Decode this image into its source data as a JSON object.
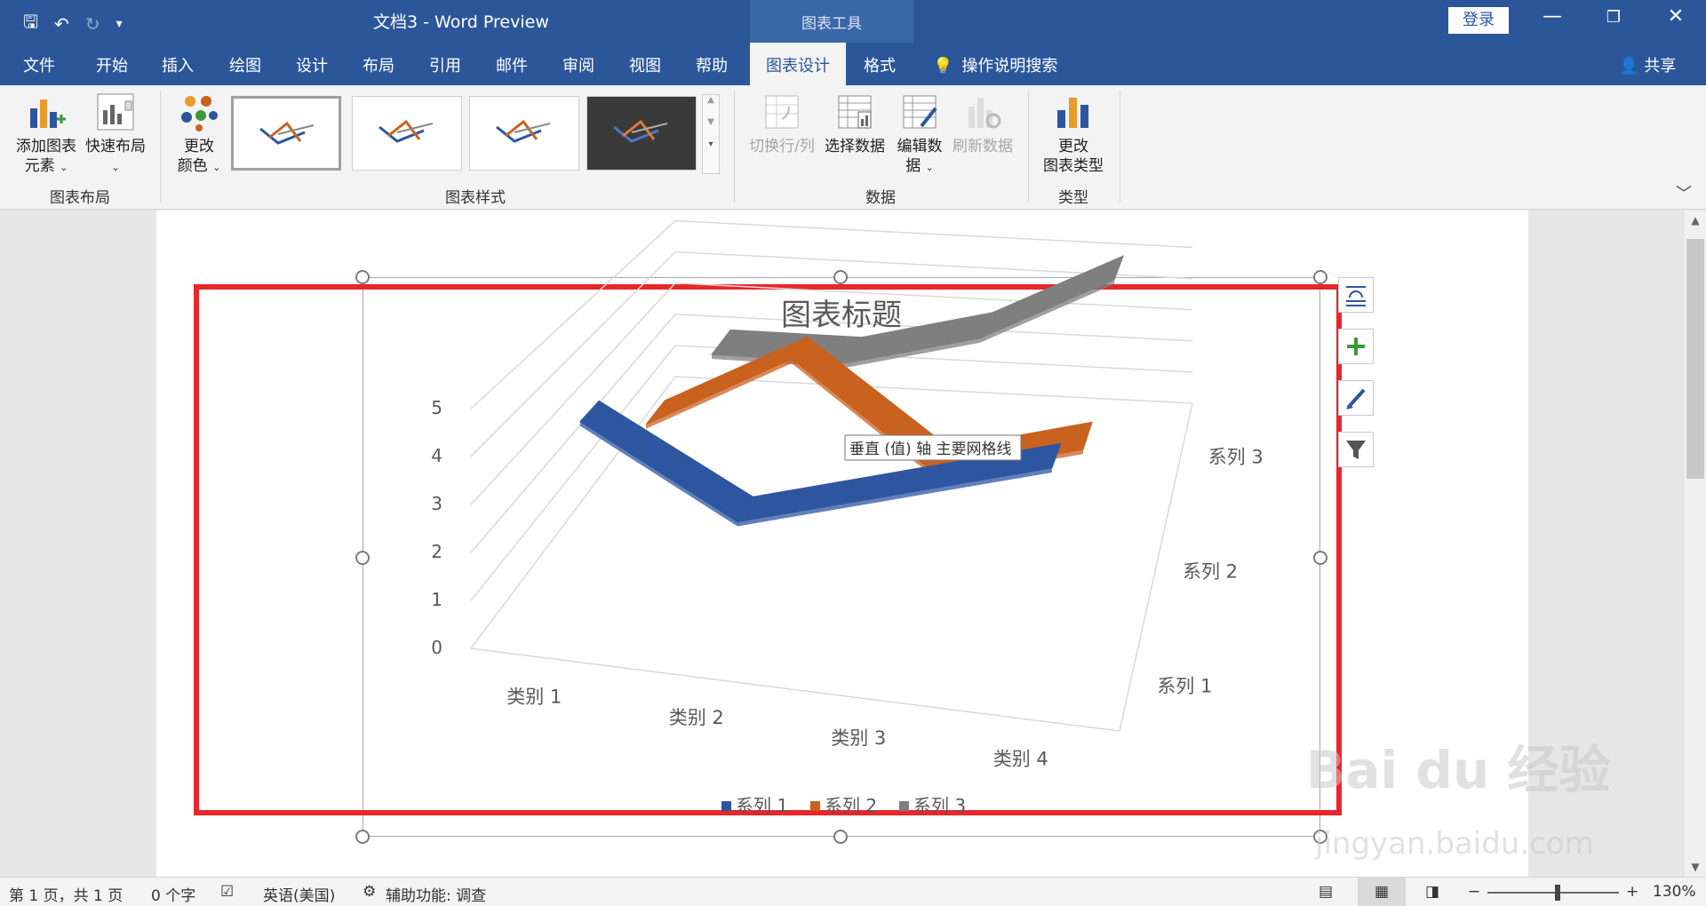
{
  "titlebar": {
    "doc_title": "文档3  -  Word Preview",
    "chart_tools": "图表工具",
    "login": "登录",
    "minimize": "—",
    "restore": "❐",
    "close": "✕",
    "qat_save": "🖫",
    "qat_undo": "↶",
    "qat_redo": "↻",
    "qat_more": "▾"
  },
  "tabs": {
    "items": [
      "文件",
      "开始",
      "插入",
      "绘图",
      "设计",
      "布局",
      "引用",
      "邮件",
      "审阅",
      "视图",
      "帮助"
    ],
    "active": "图表设计",
    "format": "格式",
    "search": "操作说明搜索",
    "share": "共享"
  },
  "ribbon": {
    "add_element": "添加图表\n元素",
    "quick_layout": "快速布局",
    "change_color": "更改\n颜色",
    "switch_rowcol": "切换行/列",
    "select_data": "选择数据",
    "edit_data": "编辑数\n据",
    "refresh_data": "刷新数据",
    "change_type": "更改\n图表类型",
    "groups": {
      "layout": "图表布局",
      "styles": "图表样式",
      "data": "数据",
      "type": "类型"
    },
    "collapse": "﹀"
  },
  "chart": {
    "tooltip": "垂直 (值) 轴 主要网格线"
  },
  "chart_data": {
    "type": "line",
    "title": "图表标题",
    "categories": [
      "类别 1",
      "类别 2",
      "类别 3",
      "类别 4"
    ],
    "y_ticks": [
      "0",
      "1",
      "2",
      "3",
      "4",
      "5"
    ],
    "ylim": [
      0,
      5
    ],
    "series": [
      {
        "name": "系列 1",
        "values": [
          4.3,
          2.5,
          3.5,
          4.5
        ],
        "color": "#2e56a0"
      },
      {
        "name": "系列 2",
        "values": [
          2.4,
          4.4,
          1.8,
          2.8
        ],
        "color": "#c9611f"
      },
      {
        "name": "系列 3",
        "values": [
          2.0,
          2.0,
          3.0,
          5.0
        ],
        "color": "#7f7f7f"
      }
    ],
    "depth_labels": [
      "系列 3",
      "系列 2",
      "系列 1"
    ],
    "legend": "bottom",
    "grid": true
  },
  "status": {
    "page": "第 1 页，共 1 页",
    "words": "0 个字",
    "language": "英语(美国)",
    "accessibility": "辅助功能: 调查",
    "zoom": "130%",
    "zoom_minus": "−",
    "zoom_plus": "+"
  },
  "watermark": {
    "brand": "Bai du 经验",
    "url": "jingyan.baidu.com"
  }
}
